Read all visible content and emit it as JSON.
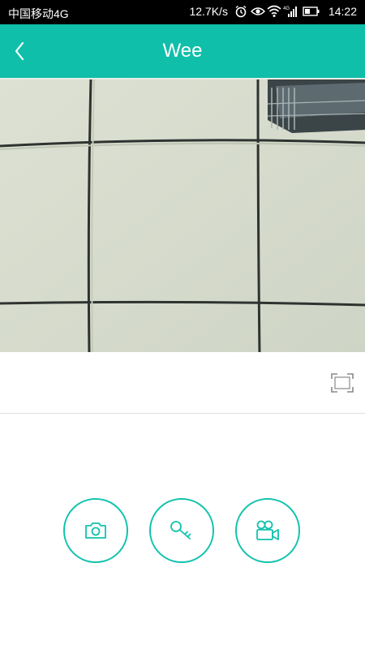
{
  "status_bar": {
    "carrier": "中国移动4G",
    "net_speed": "12.7K/s",
    "signal_label": "4G",
    "time": "14:22",
    "icons": [
      "alarm-icon",
      "eye-icon",
      "wifi-icon",
      "signal-icon",
      "battery-icon"
    ]
  },
  "app_bar": {
    "title": "Wee",
    "back_icon": "chevron-left-icon"
  },
  "video_view": {
    "icon": "fullscreen-icon"
  },
  "actions": [
    {
      "name": "snapshot",
      "icon": "camera-icon"
    },
    {
      "name": "unlock",
      "icon": "key-icon"
    },
    {
      "name": "record",
      "icon": "video-camera-icon"
    }
  ],
  "colors": {
    "accent": "#0fbfaa",
    "status_bar": "#000000",
    "button_outline": "#12c2ad"
  }
}
